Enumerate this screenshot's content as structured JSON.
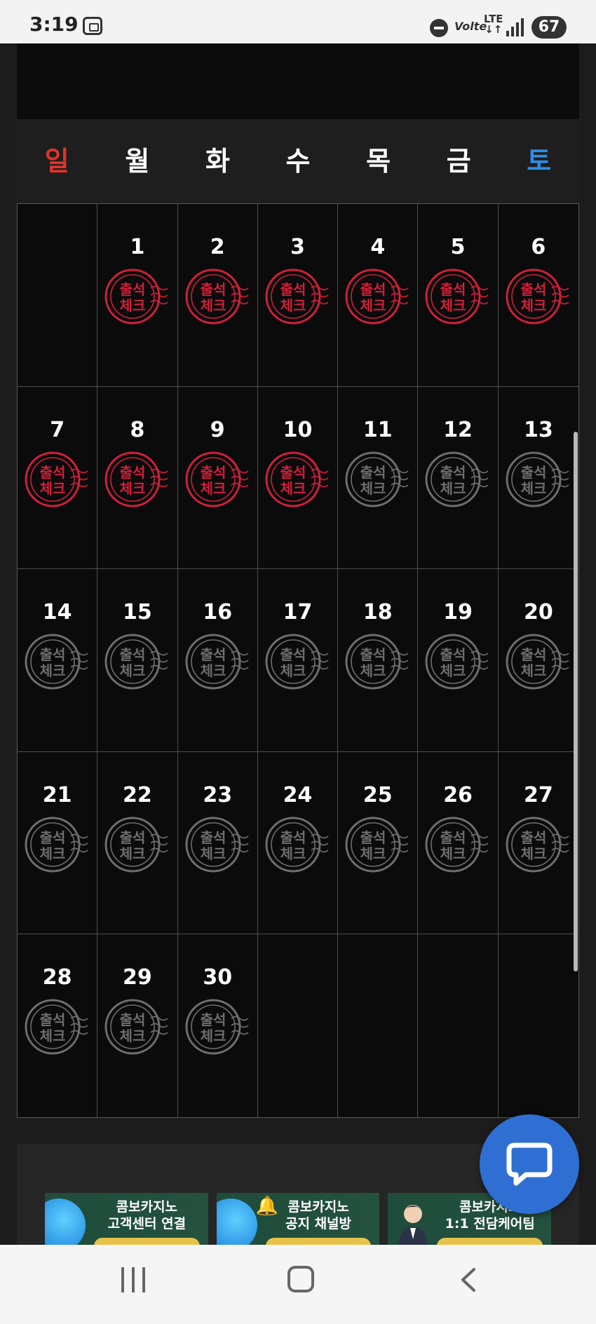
{
  "status": {
    "time": "3:19",
    "network": "LTE",
    "volte": "Volte",
    "battery": "67"
  },
  "calendar": {
    "weekdays": [
      "일",
      "월",
      "화",
      "수",
      "목",
      "금",
      "토"
    ],
    "stamp_text_top": "출석",
    "stamp_text_bottom": "체크",
    "first_weekday_offset": 1,
    "days_in_month": 30,
    "checked_through_day": 10,
    "colors": {
      "sunday": "#e0332c",
      "saturday": "#2d8fe6",
      "stamp_checked": "#d0203a",
      "stamp_unchecked": "#6e6e6e"
    }
  },
  "banners": [
    {
      "title_line1": "콤보카지노",
      "title_line2": "고객센터 연결",
      "icon": "telegram-icon"
    },
    {
      "title_line1": "콤보카지노",
      "title_line2": "공지 채널방",
      "icon": "bell-icon"
    },
    {
      "title_line1": "콤보카지노",
      "title_line2": "1:1 전담케어팀",
      "icon": "agent-avatar"
    }
  ],
  "chat_button": {
    "icon": "chat-bubble-icon"
  },
  "navigation": {
    "recent": "recent-apps-icon",
    "home": "home-icon",
    "back": "back-icon"
  }
}
